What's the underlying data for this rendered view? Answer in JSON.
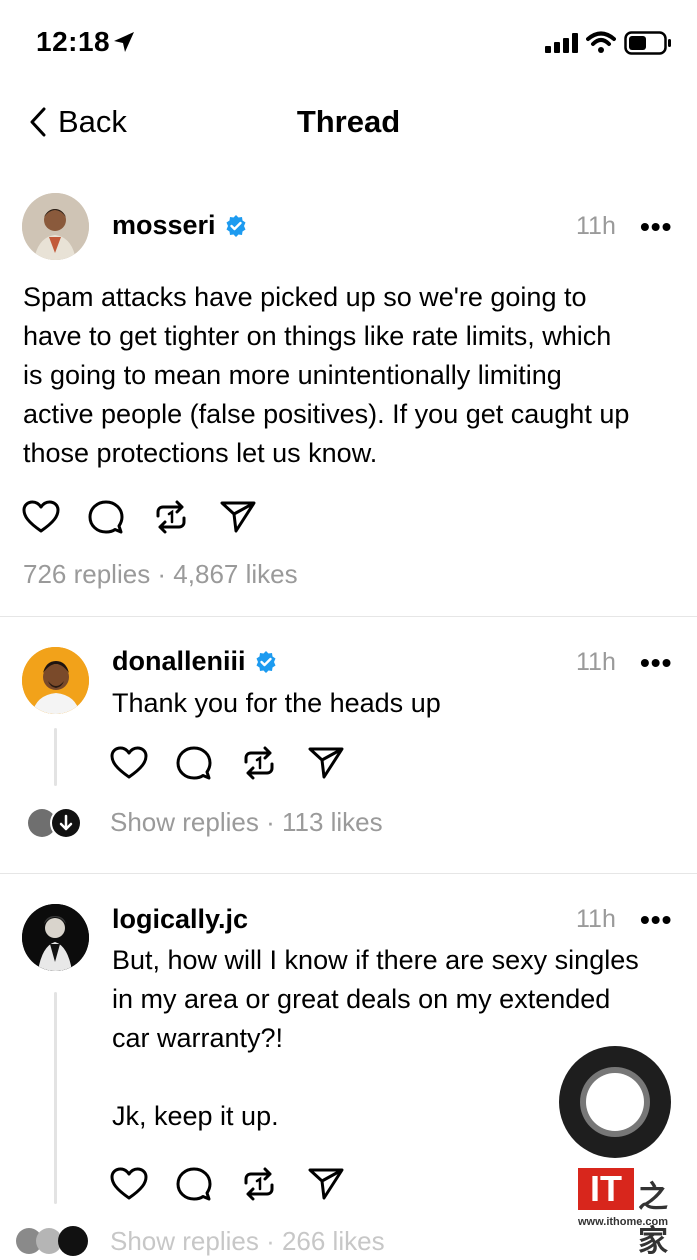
{
  "status_bar": {
    "time": "12:18"
  },
  "nav": {
    "back_label": "Back",
    "title": "Thread"
  },
  "main_post": {
    "username": "mosseri",
    "time": "11h",
    "more": "•••",
    "text_lines": [
      "Spam attacks have picked up so we're going to",
      "have to get tighter on things like rate limits, which",
      "is going to mean more unintentionally limiting",
      "active people (false positives). If you get caught up",
      "those protections let us know."
    ],
    "stats": "726 replies · 4,867 likes"
  },
  "replies": [
    {
      "username": "donalleniii",
      "time": "11h",
      "more": "•••",
      "text_lines": [
        "Thank you for the heads up"
      ],
      "footer": "Show replies · 113 likes"
    },
    {
      "username": "logically.jc",
      "time": "11h",
      "more": "•••",
      "text_lines": [
        "But, how will I know if there are sexy singles",
        "in my area or great deals on my extended",
        "car warranty?!",
        "",
        "Jk, keep it up."
      ],
      "footer": "Show replies · 266 likes"
    }
  ],
  "watermark": {
    "logo": "IT",
    "chinese": "之家",
    "url": "www.ithome.com"
  },
  "colors": {
    "verified": "#1d9bf0",
    "muted": "#9a9a9a",
    "watermark_red": "#d8261c"
  },
  "icons": [
    "location-arrow-icon",
    "signal-icon",
    "wifi-icon",
    "battery-icon",
    "chevron-left-icon",
    "verified-badge-icon",
    "heart-icon",
    "comment-icon",
    "repost-icon",
    "send-icon",
    "down-arrow-icon"
  ]
}
